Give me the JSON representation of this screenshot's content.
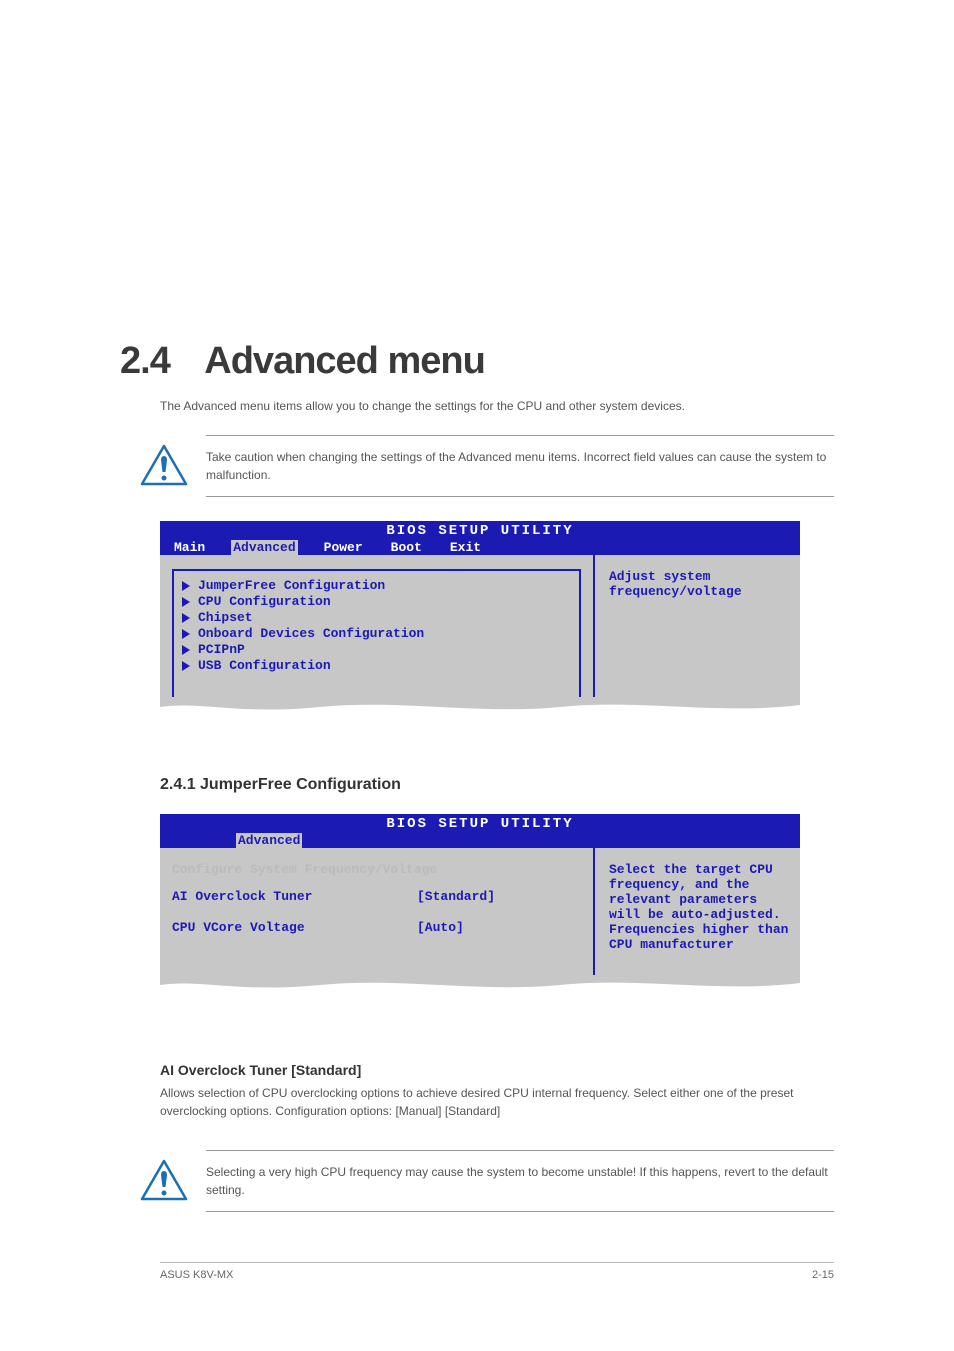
{
  "section": {
    "number": "2.4",
    "name": "Advanced menu"
  },
  "intro_text": "The Advanced menu items allow you to change the settings for the CPU and other system devices.",
  "caution1": "Take caution when changing the settings of the Advanced menu items. Incorrect field values can cause the system to malfunction.",
  "bios1": {
    "title": "BIOS SETUP UTILITY",
    "tabs": [
      "Main",
      "Advanced",
      "Power",
      "Boot",
      "Exit"
    ],
    "selected_tab": "Advanced",
    "menu_items": [
      "JumperFree Configuration",
      "CPU Configuration",
      "Chipset",
      "Onboard Devices Configuration",
      "PCIPnP",
      "USB Configuration"
    ],
    "side_text": "Adjust system frequency/voltage"
  },
  "subsection": "2.4.1 JumperFree Configuration",
  "bios2": {
    "title": "BIOS SETUP UTILITY",
    "selected_tab": "Advanced",
    "section_header": "Configure System Frequency/Voltage",
    "settings": [
      {
        "label": "AI Overclock Tuner",
        "value": "[Standard]"
      },
      {
        "label": "CPU VCore Voltage",
        "value": "[Auto]"
      }
    ],
    "side_text": "Select the target CPU frequency, and the relevant parameters will be auto-adjusted. Frequencies higher than CPU manufacturer"
  },
  "ai_section": {
    "title": "AI Overclock Tuner [Standard]",
    "body": "Allows selection of CPU overclocking options to achieve desired CPU internal frequency. Select either one of the preset overclocking options. Configuration options: [Manual] [Standard]"
  },
  "caution2": "Selecting a very high CPU frequency may cause the system to become unstable! If this happens, revert to the default setting.",
  "footer": {
    "left": "ASUS K8V-MX",
    "right": "2-15"
  }
}
